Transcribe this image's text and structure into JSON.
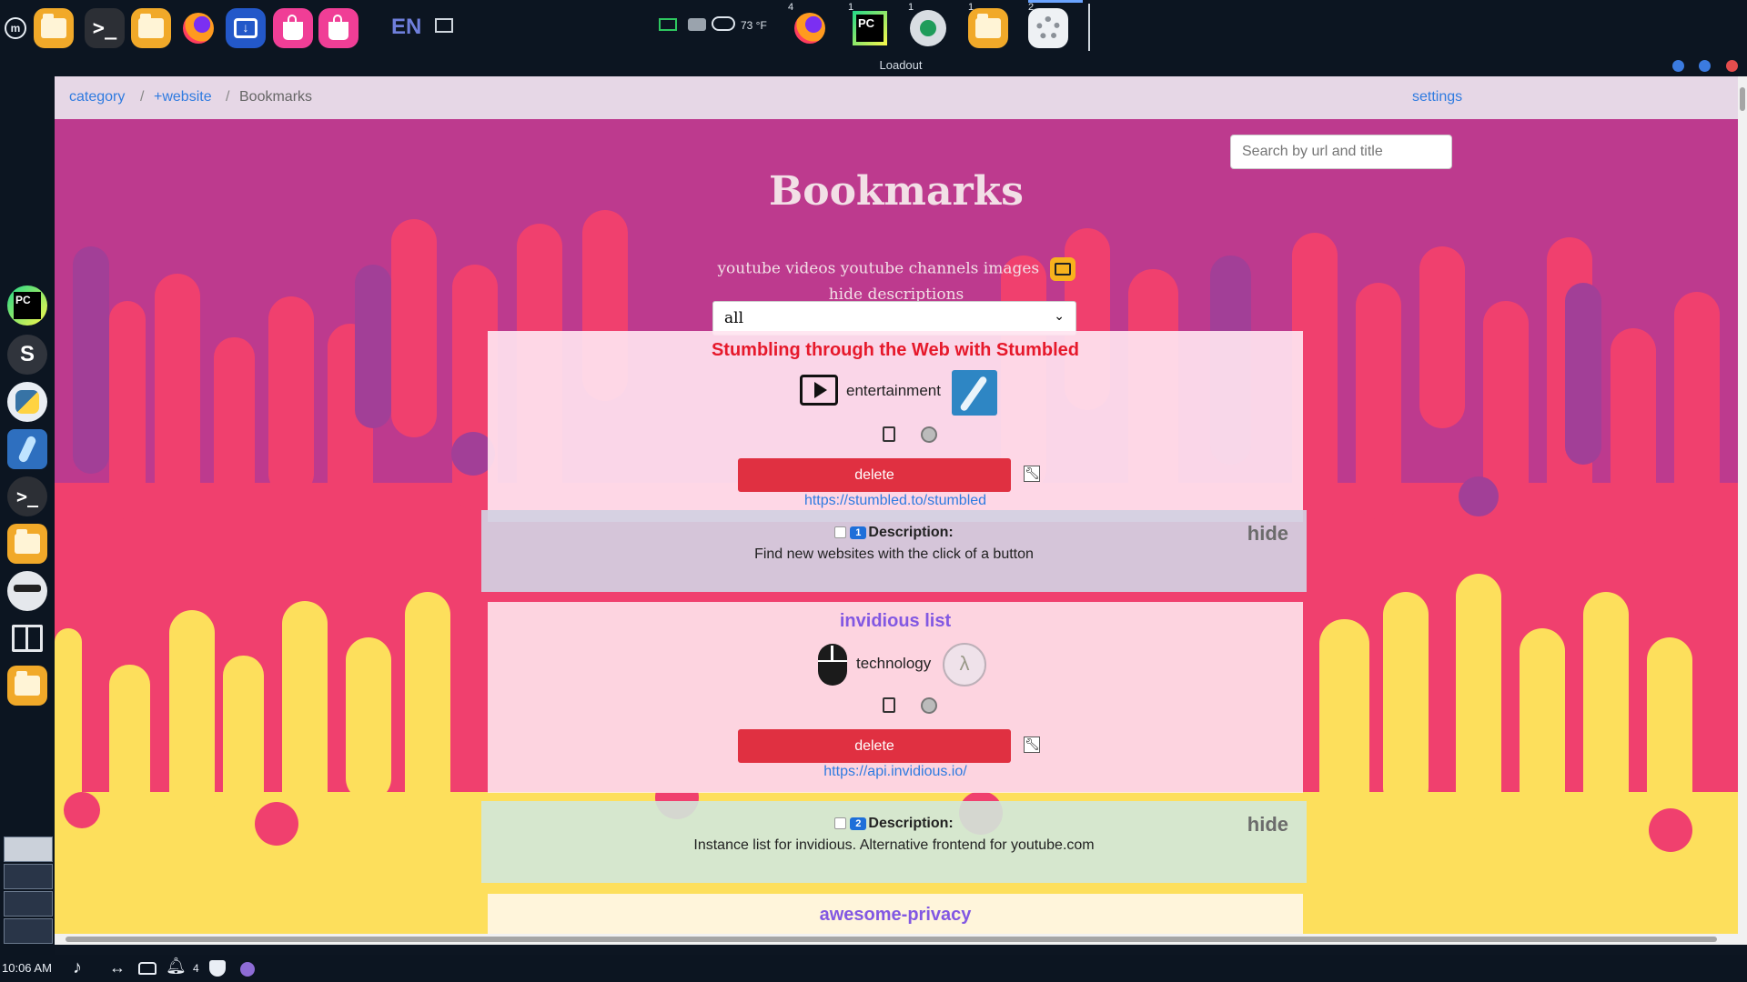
{
  "topbar": {
    "language": "EN",
    "weather": "73 °F",
    "badges": [
      "4",
      "1",
      "1",
      "1",
      "2"
    ],
    "launchers": [
      "mint-menu-icon",
      "file-manager-icon",
      "terminal-icon",
      "files-icon",
      "firefox-icon",
      "downloader-icon",
      "software-store-icon",
      "software-store-icon"
    ],
    "taskbar": [
      "firefox-icon",
      "pycharm-icon",
      "record-icon",
      "folder-icon",
      "settings-icon"
    ]
  },
  "window": {
    "title": "Loadout"
  },
  "breadcrumb": {
    "items": [
      "category",
      "+website",
      "Bookmarks"
    ],
    "settings": "settings"
  },
  "search": {
    "placeholder": "Search by url and title"
  },
  "header": {
    "title": "Bookmarks",
    "filters": "youtube videos youtube channels images",
    "hide_descriptions": "hide descriptions",
    "filter_icon": "list-icon"
  },
  "select": {
    "value": "all"
  },
  "bookmarks": [
    {
      "title": "Stumbling through the Web with Stumbled",
      "title_color": "#e6192b",
      "category": "entertainment",
      "category_icon": "tv-play-icon",
      "delete": "delete",
      "url": "https://stumbled.to/stumbled",
      "desc_number": "1",
      "desc_label": "Description:",
      "description": "Find new websites with the click of a button",
      "hide": "hide"
    },
    {
      "title": "invidious list",
      "title_color": "#8258e2",
      "category": "technology",
      "category_icon": "mouse-icon",
      "delete": "delete",
      "url": "https://api.invidious.io/",
      "desc_number": "2",
      "desc_label": "Description:",
      "description": "Instance list for invidious. Alternative frontend for youtube.com",
      "hide": "hide"
    },
    {
      "title": "awesome-privacy",
      "title_color": "#8258e2"
    }
  ],
  "taskbar_bottom": {
    "clock": "10:06 AM",
    "notifications": "4"
  },
  "colors": {
    "page_bg": "#bd3a8e",
    "drip_pink": "#f0406e",
    "drip_yellow": "#fddf5c",
    "delete_red": "#e03041",
    "link_blue": "#2f7be0"
  }
}
